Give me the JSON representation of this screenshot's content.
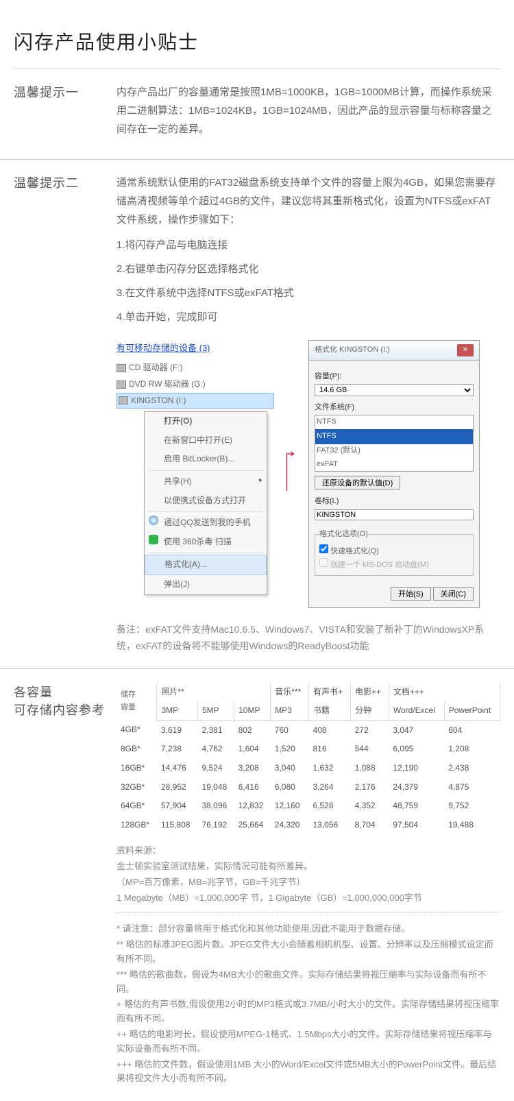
{
  "title": "闪存产品使用小贴士",
  "tip1": {
    "label": "温馨提示一",
    "text": "内存产品出厂的容量通常是按照1MB=1000KB，1GB=1000MB计算，而操作系统采用二进制算法：1MB=1024KB，1GB=1024MB，因此产品的显示容量与标称容量之间存在一定的差异。"
  },
  "tip2": {
    "label": "温馨提示二",
    "intro": "通常系统默认使用的FAT32磁盘系统支持单个文件的容量上限为4GB，如果您需要存储高清视频等单个超过4GB的文件，建议您将其重新格式化，设置为NTFS或exFAT文件系统，操作步骤如下：",
    "steps": [
      "1.将闪存产品与电脑连接",
      "2.右键单击闪存分区选择格式化",
      "3.在文件系统中选择NTFS或exFAT格式",
      "4.单击开始，完成即可"
    ],
    "explorer": {
      "header": "有可移动存储的设备 (3)",
      "devices": [
        "CD 驱动器 (F:)",
        "DVD RW 驱动器 (G:)",
        "KINGSTON (I:)"
      ],
      "context_menu": [
        {
          "label": "打开(O)",
          "bold": true
        },
        {
          "label": "在新窗口中打开(E)"
        },
        {
          "label": "启用 BitLocker(B)..."
        },
        {
          "sep": true
        },
        {
          "label": "共享(H)",
          "arrow": true
        },
        {
          "label": "以便携式设备方式打开"
        },
        {
          "sep": true
        },
        {
          "label": "通过QQ发送到我的手机",
          "icon": "qq"
        },
        {
          "label": "使用 360杀毒 扫描",
          "icon": "360"
        },
        {
          "sep": true
        },
        {
          "label": "格式化(A)...",
          "hl": true
        },
        {
          "label": "弹出(J)"
        }
      ]
    },
    "dialog": {
      "title": "格式化 KINGSTON (I:)",
      "capacity_label": "容量(P):",
      "capacity_value": "14.6 GB",
      "fs_label": "文件系统(F)",
      "fs_selected": "NTFS",
      "fs_options": [
        "NTFS",
        "FAT32 (默认)",
        "exFAT"
      ],
      "restore_btn": "还原设备的默认值(D)",
      "volume_label": "卷标(L)",
      "volume_value": "KINGSTON",
      "options_legend": "格式化选项(O)",
      "quick_fmt": "快速格式化(Q)",
      "msdos": "创建一个 MS-DOS 启动盘(M)",
      "start_btn": "开始(S)",
      "close_btn": "关闭(C)"
    },
    "note": "备注：exFAT文件支持Mac10.6.5、Windows7、VISTA和安装了新补丁的WindowsXP系统，exFAT的设备将不能够使用Windows的ReadyBoost功能"
  },
  "storage": {
    "label1": "各容量",
    "label2": "可存储内容参考",
    "group_headers": {
      "capacity": "储存\n容量",
      "photo": "照片**",
      "music": "音乐***",
      "audiobook": "有声书+",
      "movie": "电影++",
      "document": "文档+++"
    },
    "sub_headers": [
      "3MP",
      "5MP",
      "10MP",
      "MP3",
      "书籍",
      "分钟",
      "Word/Excel",
      "PowerPoint"
    ],
    "rows": [
      {
        "cap": "4GB*",
        "v": [
          "3,619",
          "2,381",
          "802",
          "760",
          "408",
          "272",
          "3,047",
          "604"
        ]
      },
      {
        "cap": "8GB*",
        "v": [
          "7,238",
          "4,762",
          "1,604",
          "1,520",
          "816",
          "544",
          "6,095",
          "1,208"
        ]
      },
      {
        "cap": "16GB*",
        "v": [
          "14,476",
          "9,524",
          "3,208",
          "3,040",
          "1,632",
          "1,088",
          "12,190",
          "2,438"
        ]
      },
      {
        "cap": "32GB*",
        "v": [
          "28,952",
          "19,048",
          "6,416",
          "6,080",
          "3,264",
          "2,176",
          "24,379",
          "4,875"
        ]
      },
      {
        "cap": "64GB*",
        "v": [
          "57,904",
          "38,096",
          "12,832",
          "12,160",
          "6,528",
          "4,352",
          "48,759",
          "9,752"
        ]
      },
      {
        "cap": "128GB*",
        "v": [
          "115,808",
          "76,192",
          "25,664",
          "24,320",
          "13,056",
          "8,704",
          "97,504",
          "19,488"
        ]
      }
    ],
    "source": [
      "资料来源：",
      "金士顿实验室测试结果，实际情况可能有所差异。",
      "（MP=百万像素，MB=兆字节，GB=千兆字节）",
      "1 Megabyte（MB）=1,000,000字 节，1 Gigabyte（GB）=1,000,000,000字节"
    ],
    "footnotes": [
      "* 请注意：部分容量将用于格式化和其他功能使用,因此不能用于数据存储。",
      "** 略估的标准JPEG图片数。JPEG文件大小会随着相机机型、设置、分辨率以及压缩模式设定而有所不同。",
      "*** 略估的歌曲数，假设为4MB大小的歌曲文件。实际存储结果将视压缩率与实际设备而有所不同。",
      "+ 略估的有声书数,假设使用2小时的MP3格式或3.7MB/小时大小的文件。实际存储结果将视压缩率而有所不同。",
      "++ 略估的电影时长，假设使用MPEG-1格式、1.5Mbps大小的文件。实际存储结果将视压缩率与实际设备而有所不同。",
      "+++ 略估的文件数，假设使用1MB 大小的Word/Excel文件或5MB大小的PowerPoint文件。最后结果将视文件大小而有所不同。"
    ]
  }
}
